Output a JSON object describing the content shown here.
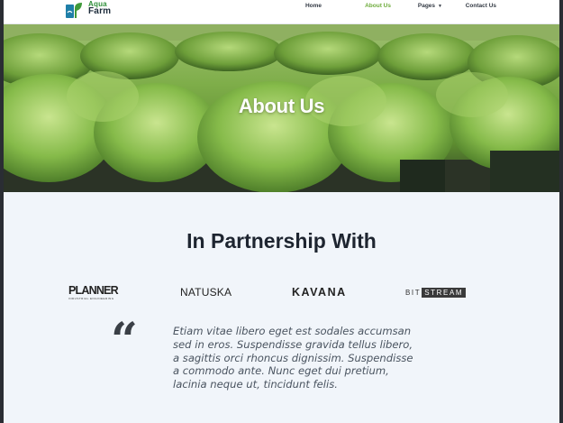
{
  "header": {
    "logo": {
      "line1": "Aqua",
      "line2": "Farm"
    },
    "nav": [
      {
        "label": "Home"
      },
      {
        "label": "About Us"
      },
      {
        "label": "Pages"
      },
      {
        "label": "Contact Us"
      }
    ]
  },
  "hero": {
    "title": "About Us"
  },
  "partnership": {
    "title": "In Partnership With",
    "partners": {
      "planner": {
        "name": "PLANNER",
        "sub": "INDUSTRIAL ENGINEERING"
      },
      "natuska": {
        "name": "NATUSKA"
      },
      "kavana": {
        "name": "KAVANA"
      },
      "bitstream": {
        "bit": "BIT",
        "stream": "STREAM"
      }
    }
  },
  "testimonial": {
    "quote_icon": "quote-icon",
    "text": "Etiam vitae libero eget est sodales accumsan sed in eros. Suspendisse gravida tellus libero, a sagittis orci rhoncus dignissim. Suspendisse a commodo ante. Nunc eget dui pretium, lacinia neque ut, tincidunt felis."
  },
  "colors": {
    "accent": "#6dab3a",
    "dark": "#1e2530",
    "background": "#f1f5fa"
  }
}
